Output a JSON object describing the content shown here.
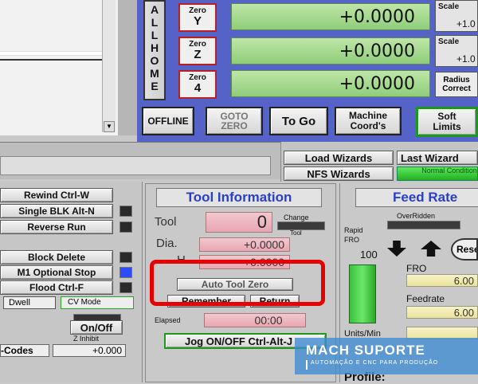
{
  "zero_buttons": [
    {
      "top": "Zero",
      "bottom": "Y"
    },
    {
      "top": "Zero",
      "bottom": "Z"
    },
    {
      "top": "Zero",
      "bottom": "4"
    }
  ],
  "dro_values": [
    "+0.0000",
    "+0.0000",
    "+0.0000"
  ],
  "scale_labels": [
    "Scale",
    "Scale"
  ],
  "scale_values": [
    "+1.0",
    "+1.0"
  ],
  "radius_correct": "Radius Correct",
  "all_home": [
    "A",
    "L",
    "L",
    "H",
    "O",
    "M",
    "E"
  ],
  "top_buttons": {
    "offline": "OFFLINE",
    "goto_zero": "GOTO ZERO",
    "to_go": "To Go",
    "machine_coords": "Machine Coord's",
    "soft_limits": "Soft Limits"
  },
  "wizards": {
    "load": "Load Wizards",
    "nfs": "NFS Wizards",
    "last": "Last Wizard",
    "normal": "Normal Condition"
  },
  "left_buttons": {
    "rewind": "Rewind Ctrl-W",
    "single_blk": "Single BLK Alt-N",
    "reverse_run": "Reverse Run",
    "block_delete": "Block Delete",
    "m1_stop": "M1 Optional Stop",
    "flood": "Flood Ctrl-F",
    "dwell": "Dwell",
    "cv_mode": "CV Mode",
    "on_off": "On/Off",
    "z_inhibit": "Z Inhibit",
    "codes": "-Codes",
    "z_inhibit_value": "+0.000"
  },
  "tool_info": {
    "title": "Tool Information",
    "tool_label": "Tool",
    "tool_value": "0",
    "change_label": "Change",
    "tool_small": "Tool",
    "dia_label": "Dia.",
    "dia_value": "+0.0000",
    "h_label": "H",
    "h_value": "+0.0000",
    "auto_tool_zero": "Auto Tool Zero",
    "remember": "Remember",
    "return": "Return",
    "elapsed_label": "Elapsed",
    "elapsed_value": "00:00",
    "jog": "Jog ON/OFF Ctrl-Alt-J"
  },
  "feed": {
    "title": "Feed Rate",
    "overridden": "OverRidden",
    "rapid_fro": "Rapid FRO",
    "rapid_value": "100",
    "fro_label": "FRO",
    "fro_value": "6.00",
    "feedrate_label": "Feedrate",
    "feedrate_value": "6.00",
    "units_min": "Units/Min",
    "reset": "Rese",
    "profile": "Profile:"
  },
  "watermark": {
    "title": "MACH SUPORTE",
    "subtitle": "AUTOMAÇÃO E CNC PARA PRODUÇÃO"
  },
  "colors": {
    "highlight": "#e60000",
    "title_blue": "#2a3fc8",
    "dro_green": "#a8dc92"
  }
}
